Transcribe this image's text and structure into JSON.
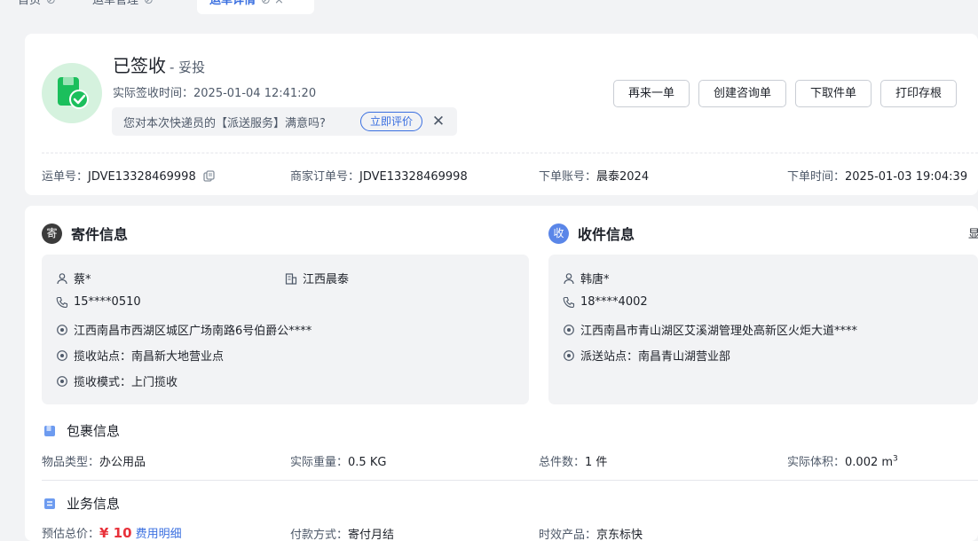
{
  "tabs": [
    {
      "label": "首页",
      "close": "⊘"
    },
    {
      "label": "运单管理",
      "close": "⊘"
    },
    {
      "label": "运单详情",
      "close": "⊘ ×"
    }
  ],
  "status": {
    "title": "已签收",
    "subtitle": "- 妥投",
    "sign_time_label": "实际签收时间：",
    "sign_time_value": "2025-01-04 12:41:20",
    "survey_question": "您对本次快递员的【派送服务】满意吗?",
    "survey_action": "立即评价",
    "accent_color": "#1bbf5c"
  },
  "actions": {
    "reorder": "再来一单",
    "consult": "创建咨询单",
    "pickup": "下取件单",
    "print": "打印存根"
  },
  "order_meta": {
    "waybill_label": "运单号：",
    "waybill_value": "JDVE13328469998",
    "merchant_label": "商家订单号：",
    "merchant_value": "JDVE13328469998",
    "account_label": "下单账号：",
    "account_value": "晨泰2024",
    "time_label": "下单时间：",
    "time_value": "2025-01-03 19:04:39"
  },
  "sender": {
    "badge": "寄",
    "title": "寄件信息",
    "name": "蔡*",
    "company": "江西晨泰",
    "phone": "15****0510",
    "address": "江西南昌市西湖区城区广场南路6号伯爵公****",
    "station": "揽收站点：南昌新大地营业点",
    "mode": "揽收模式：上门揽收"
  },
  "receiver": {
    "badge": "收",
    "title": "收件信息",
    "cut_label": "显",
    "name": "韩唐*",
    "phone": "18****4002",
    "address": "江西南昌市青山湖区艾溪湖管理处高新区火炬大道****",
    "station": "派送站点：南昌青山湖营业部"
  },
  "package": {
    "title": "包裹信息",
    "type_label": "物品类型：",
    "type_value": "办公用品",
    "weight_label": "实际重量：",
    "weight_value": "0.5 KG",
    "count_label": "总件数：",
    "count_value": "1 件",
    "volume_label": "实际体积：",
    "volume_value": "0.002 m",
    "volume_sup": "3"
  },
  "business": {
    "title": "业务信息",
    "total_label": "预估总价：",
    "total_value": "¥ 10",
    "detail_link": "费用明细",
    "pay_label": "付款方式：",
    "pay_value": "寄付月结",
    "product_label": "时效产品：",
    "product_value": "京东标快"
  }
}
